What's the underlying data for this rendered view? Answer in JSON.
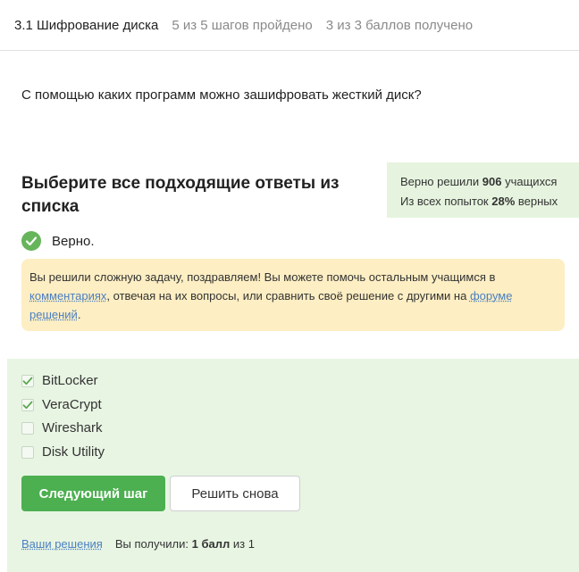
{
  "header": {
    "step_title": "3.1 Шифрование диска",
    "steps_progress": "5 из 5 шагов пройдено",
    "points_progress": "3 из 3 баллов  получено"
  },
  "question": "С помощью каких программ можно зашифровать жесткий диск?",
  "prompt": "Выберите все подходящие ответы из списка",
  "stats": {
    "solved_prefix": "Верно решили",
    "solved_count": "906",
    "solved_suffix": "учащихся",
    "attempts_prefix": "Из всех попыток",
    "attempts_percent": "28%",
    "attempts_suffix": "верных"
  },
  "verdict": {
    "text": "Верно.",
    "icon": "check-circle-icon",
    "color": "#66b55a"
  },
  "notice": {
    "text_1": "Вы решили сложную задачу, поздравляем! Вы можете помочь остальным учащимся в ",
    "link_comments": "комментариях",
    "text_2": ", отвечая на их вопросы, или сравнить своё решение с другими на ",
    "link_forum": "форуме решений",
    "text_3": "."
  },
  "options": [
    {
      "label": "BitLocker",
      "checked": true
    },
    {
      "label": "VeraCrypt",
      "checked": true
    },
    {
      "label": "Wireshark",
      "checked": false
    },
    {
      "label": "Disk Utility",
      "checked": false
    }
  ],
  "buttons": {
    "next": "Следующий шаг",
    "retry": "Решить снова"
  },
  "footer": {
    "your_solutions": "Ваши решения",
    "received_prefix": "Вы получили:",
    "received_value": "1 балл",
    "received_suffix": "из 1"
  },
  "colors": {
    "accent_green": "#4caf50",
    "answers_bg": "#e8f5e3",
    "notice_bg": "#fdeec3",
    "link": "#4a7fc1"
  }
}
